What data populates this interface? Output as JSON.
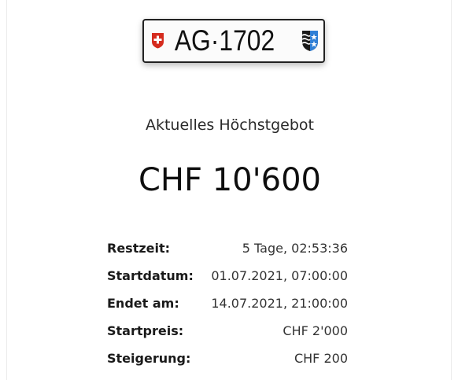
{
  "plate": {
    "number": "AG·1702",
    "left_emblem": "swiss-cross-icon",
    "right_emblem": "aargau-coat-of-arms-icon",
    "colors": {
      "swiss_red": "#d52b1e",
      "aargau_blue": "#2f7fd6",
      "aargau_black": "#1a1a1a"
    }
  },
  "auction": {
    "subtitle": "Aktuelles Höchstgebot",
    "current_bid": "CHF 10'600",
    "details": [
      {
        "label": "Restzeit:",
        "value": "5 Tage, 02:53:36"
      },
      {
        "label": "Startdatum:",
        "value": "01.07.2021, 07:00:00"
      },
      {
        "label": "Endet am:",
        "value": "14.07.2021, 21:00:00"
      },
      {
        "label": "Startpreis:",
        "value": "CHF 2'000"
      },
      {
        "label": "Steigerung:",
        "value": "CHF 200"
      }
    ]
  }
}
